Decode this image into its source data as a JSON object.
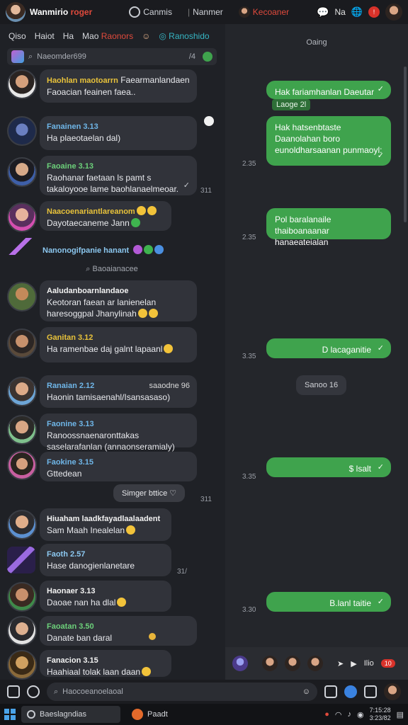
{
  "titlebar": {
    "title_main": "Wanmirio",
    "title_accent": "roger",
    "item1": "Canmis",
    "item2": "Nanmer",
    "item3": "Kecoaner",
    "right_label": "Na"
  },
  "filters": {
    "items": [
      "Qiso",
      "Haiot",
      "Ha",
      "Mao"
    ],
    "red_item": "Raonors",
    "teal_item": "Ranoshido"
  },
  "search": {
    "placeholder": "Naeomder699",
    "count": "/4"
  },
  "chats": [
    {
      "sender": "Haohlan maotoarrn",
      "text": "Faearmanlandaen Faoacian feainen faea..",
      "sender_color": "yellow"
    },
    {
      "sender": "Fanainen 3.13",
      "text": "Ha plaeotaelan dal)",
      "sender_color": "blue"
    },
    {
      "sender": "Faoaine 3.13",
      "text": "Raohanar faetaan ls pamt s takaloyooe lame baohlanaelmeoar.",
      "sender_color": "green",
      "time": "311"
    },
    {
      "sender": "Naacoenariantlareanom",
      "text": "Dayotaecaneme Jann",
      "sender_color": "yellow"
    },
    {
      "sender": "Nanonogifpanie hanant",
      "text": "",
      "sender_color": "lightblue"
    },
    {
      "sender": "Aaludanboarnlandaoe",
      "text": "Keotoran faean ar lanienelan haresoggpal Jhanylinah",
      "sender_color": "white"
    },
    {
      "sender": "Ganitan 3.12",
      "text": "Ha ramenbae daj galnt lapaanl",
      "sender_color": "yellow"
    },
    {
      "sender": "Ranaian 2.12",
      "text": "Haonin tamisaenahl/Isansasaso)",
      "sender_color": "blue",
      "extra": "saaodne 96"
    },
    {
      "sender": "Faonine 3.13",
      "text": "Ranoossnaenaronttakas saselarafanlan (annaonseramialy)",
      "sender_color": "blue"
    },
    {
      "sender": "Faokine 3.15",
      "text": "Gttedean",
      "sender_color": "blue"
    },
    {
      "sender": "Hiuaham laadkfayadlaalaadent",
      "text": "Sam Maah Inealelan",
      "sender_color": "white"
    },
    {
      "sender": "Faoth 2.57",
      "text": "Hase danogienlanetare",
      "sender_color": "lightblue",
      "time": "31/"
    },
    {
      "sender": "Haonaer 3.13",
      "text": "Daoae nan ha dlal",
      "sender_color": "white"
    },
    {
      "sender": "Faoatan 3.50",
      "text": "Danate ban daral",
      "sender_color": "green"
    },
    {
      "sender": "Fanacion 3.15",
      "text": "Haahiaal tolak laan daan",
      "sender_color": "white"
    }
  ],
  "notes": {
    "center1": "Baoaianacee",
    "sticker": "Simger bttice",
    "sticker_time": "311"
  },
  "right": {
    "header": "Oaing",
    "quote": "Laoge 2l",
    "messages": [
      {
        "text": "Hak fariamhanlan Daeutar",
        "time": ""
      },
      {
        "text": "Hak hatsenbtaste Daanolahan boro eunoldharsaanan punmaoyl:",
        "time": "2.35"
      },
      {
        "text": "Pol baralanaile thaiboanaanar hanaeateialan",
        "time": "2.35"
      },
      {
        "text": "D lacaganitie",
        "time": "3.35"
      },
      {
        "text": "$ lsalt",
        "time": "3.35"
      },
      {
        "text": "B.lanl taitie",
        "time": "3.30"
      }
    ],
    "day_pill": "Sanoo 16"
  },
  "rbar": {
    "label": "Ilio",
    "badge": "10"
  },
  "input": {
    "placeholder": "Haocoeanoelaoal"
  },
  "taskbar": {
    "search": "Baeslagndias",
    "app": "Paadt",
    "clock_time": "7:15:28",
    "clock_date": "3:23/82"
  }
}
